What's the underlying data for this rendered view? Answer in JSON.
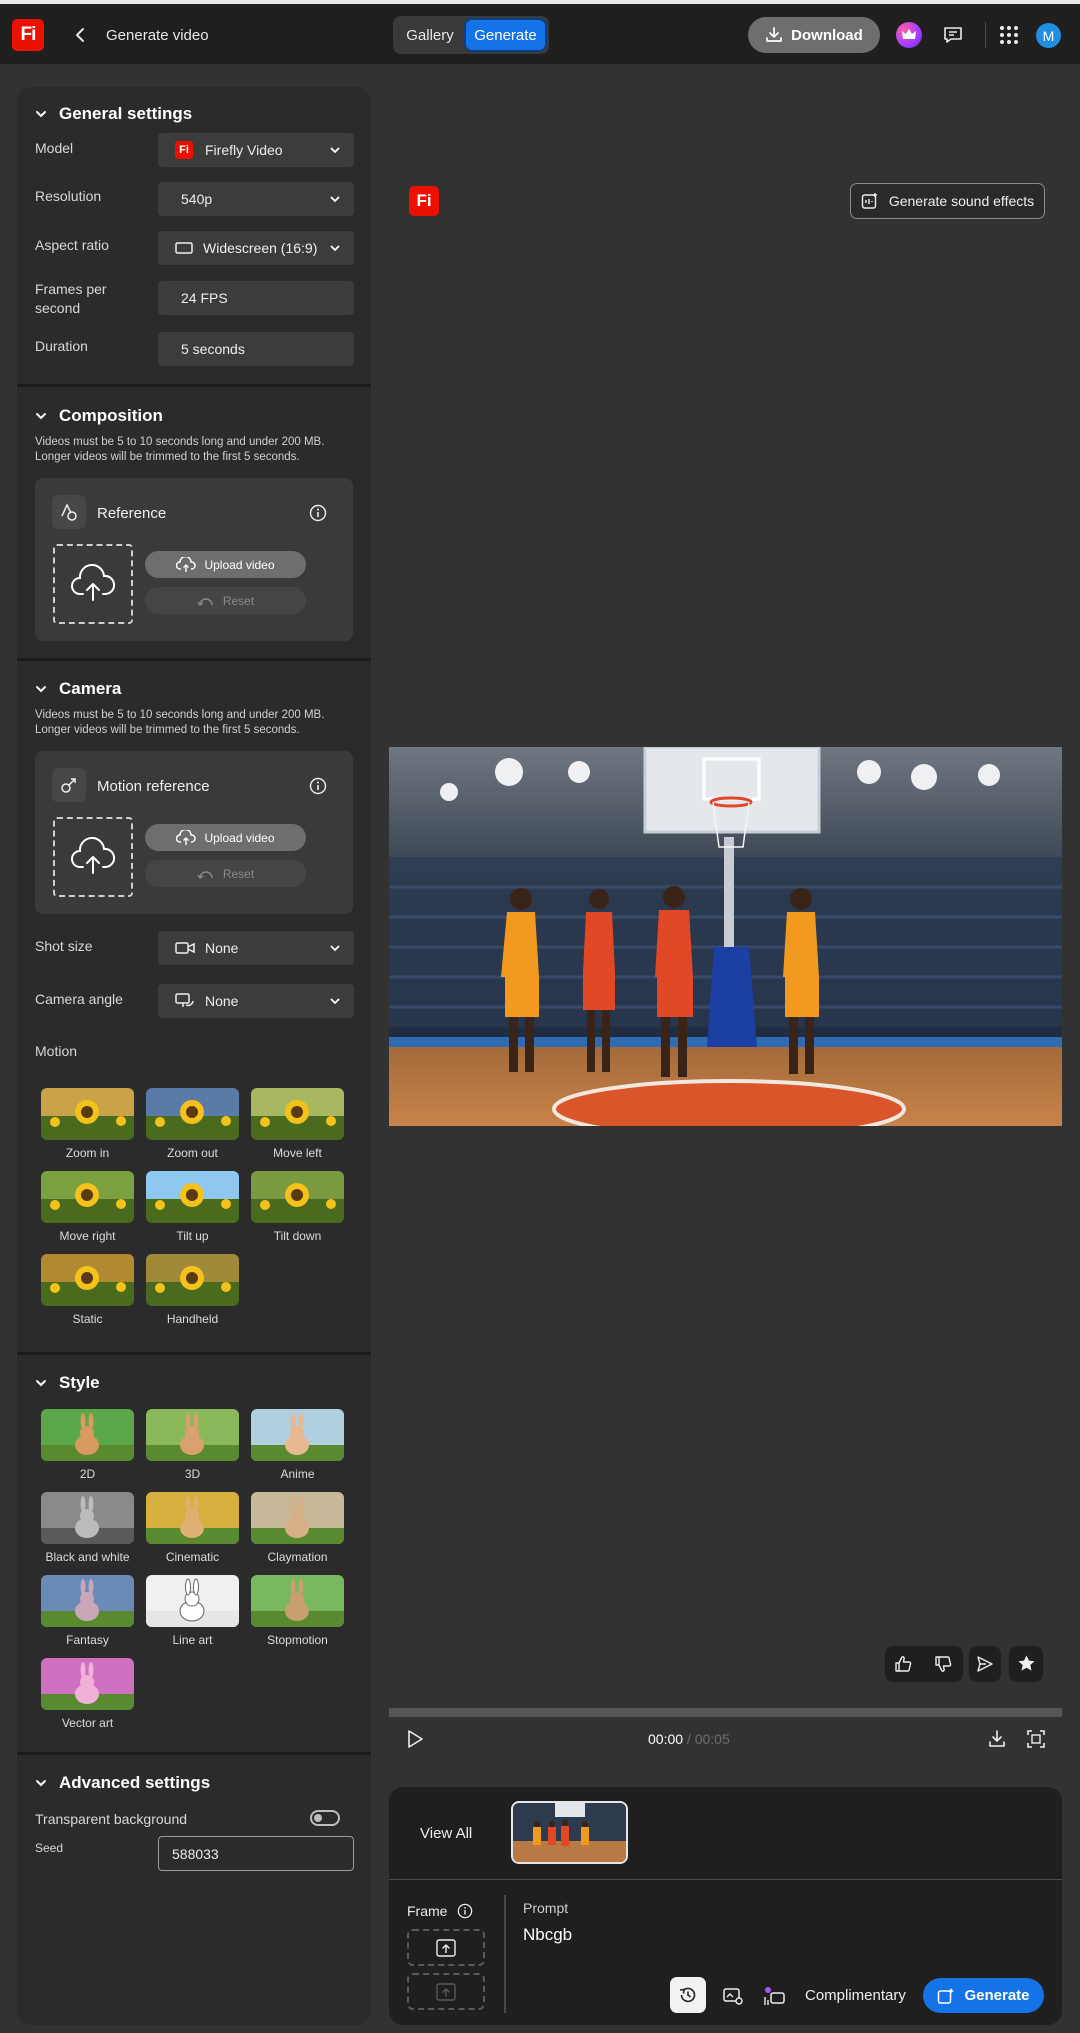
{
  "header": {
    "logo_text": "Fi",
    "title": "Generate video",
    "tabs": [
      "Gallery",
      "Generate"
    ],
    "active_tab": "Generate",
    "download_label": "Download",
    "avatar_initial": "M",
    "accent_color": "#1473e6"
  },
  "general": {
    "heading": "General settings",
    "model_label": "Model",
    "model_value": "Firefly Video",
    "model_badge": "Fi",
    "resolution_label": "Resolution",
    "resolution_value": "540p",
    "aspect_label": "Aspect ratio",
    "aspect_value": "Widescreen (16:9)",
    "fps_label_1": "Frames per",
    "fps_label_2": "second",
    "fps_value": "24 FPS",
    "duration_label": "Duration",
    "duration_value": "5 seconds"
  },
  "composition": {
    "heading": "Composition",
    "note_1": "Videos must be 5 to 10 seconds long and under 200 MB.",
    "note_2": "Longer videos will be trimmed to the first 5 seconds.",
    "ref_title": "Reference",
    "upload_label": "Upload video",
    "reset_label": "Reset"
  },
  "camera": {
    "heading": "Camera",
    "note_1": "Videos must be 5 to 10 seconds long and under 200 MB.",
    "note_2": "Longer videos will be trimmed to the first 5 seconds.",
    "ref_title": "Motion reference",
    "upload_label": "Upload video",
    "reset_label": "Reset",
    "shot_label": "Shot size",
    "shot_value": "None",
    "angle_label": "Camera angle",
    "angle_value": "None",
    "motion_label": "Motion",
    "motions": [
      "Zoom in",
      "Zoom out",
      "Move left",
      "Move right",
      "Tilt up",
      "Tilt down",
      "Static",
      "Handheld"
    ]
  },
  "style": {
    "heading": "Style",
    "items": [
      "2D",
      "3D",
      "Anime",
      "Black and white",
      "Cinematic",
      "Claymation",
      "Fantasy",
      "Line art",
      "Stopmotion",
      "Vector art"
    ]
  },
  "advanced": {
    "heading": "Advanced settings",
    "transparent_label": "Transparent background",
    "transparent_on": false,
    "seed_label": "Seed",
    "seed_value": "588033"
  },
  "preview": {
    "badge": "Fi",
    "sound_label": "Generate sound effects",
    "time_current": "00:00",
    "time_sep": " / ",
    "time_total": "00:05",
    "progress": 0
  },
  "bottom": {
    "view_all": "View All",
    "frame_label": "Frame",
    "prompt_label": "Prompt",
    "prompt_value": "Nbcgb",
    "complimentary": "Complimentary",
    "generate_label": "Generate"
  }
}
